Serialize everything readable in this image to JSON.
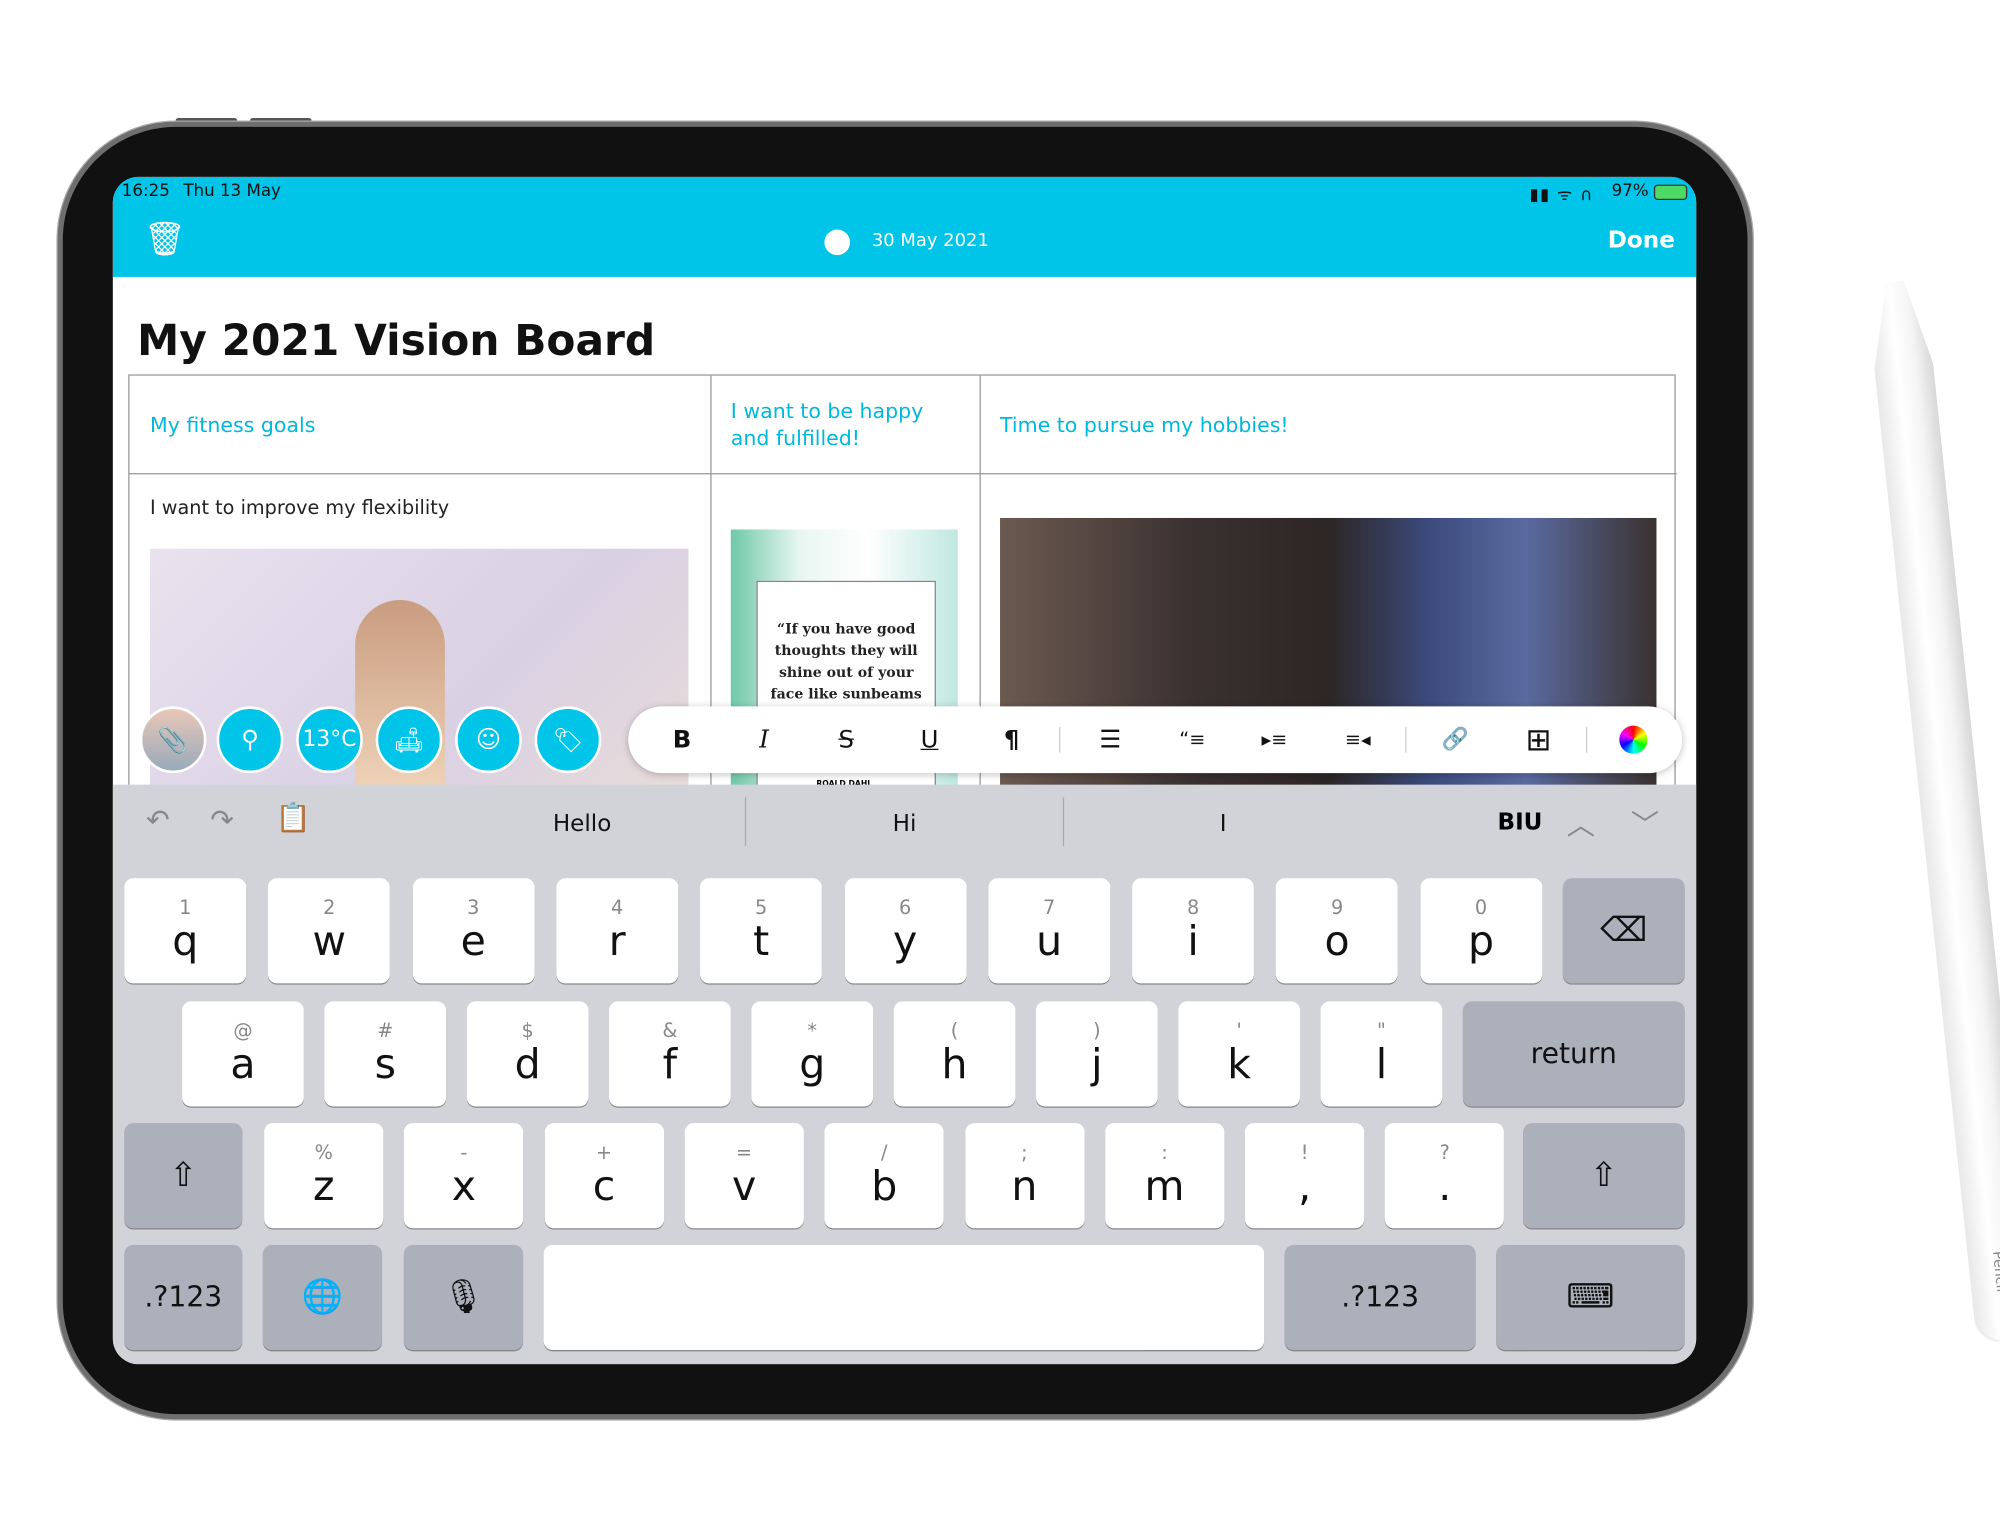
{
  "status_bar": {
    "time": "16:25",
    "date": "Thu 13 May",
    "battery": "97%"
  },
  "header": {
    "date": "30 May 2021",
    "done_label": "Done",
    "accent": "#00c4e8"
  },
  "document": {
    "title": "My 2021 Vision Board",
    "columns": [
      {
        "heading": "My fitness goals",
        "body": "I want to improve my flexibility"
      },
      {
        "heading": "I want to be happy and fulfilled!",
        "quote": "“If you have good thoughts they will shine out of your face like sunbeams",
        "author": "ROALD DAHL"
      },
      {
        "heading": "Time to pursue my hobbies!"
      }
    ]
  },
  "attachment_buttons": [
    {
      "icon": "paperclip-icon"
    },
    {
      "icon": "location-pin-icon"
    },
    {
      "icon": "weather",
      "label": "13°C"
    },
    {
      "icon": "sofa-icon"
    },
    {
      "icon": "smiley-icon"
    },
    {
      "icon": "tag-icon"
    }
  ],
  "format_toolbar": [
    {
      "icon": "bold-icon",
      "glyph": "B"
    },
    {
      "icon": "italic-icon",
      "glyph": "I"
    },
    {
      "icon": "strikethrough-icon",
      "glyph": "S"
    },
    {
      "icon": "underline-icon",
      "glyph": "U"
    },
    {
      "icon": "paragraph-icon",
      "glyph": "¶"
    },
    {
      "icon": "bullet-list-icon",
      "glyph": "☰"
    },
    {
      "icon": "quote-icon",
      "glyph": "“≡"
    },
    {
      "icon": "indent-icon",
      "glyph": "▸≡"
    },
    {
      "icon": "outdent-icon",
      "glyph": "≡◂"
    },
    {
      "icon": "link-icon",
      "glyph": "🔗"
    },
    {
      "icon": "table-icon",
      "glyph": "⊞"
    },
    {
      "icon": "color-wheel-icon",
      "glyph": ""
    }
  ],
  "keyboard": {
    "suggestions": [
      "Hello",
      "Hi",
      "I"
    ],
    "biu": "BIU",
    "row1": [
      [
        "1",
        "q"
      ],
      [
        "2",
        "w"
      ],
      [
        "3",
        "e"
      ],
      [
        "4",
        "r"
      ],
      [
        "5",
        "t"
      ],
      [
        "6",
        "y"
      ],
      [
        "7",
        "u"
      ],
      [
        "8",
        "i"
      ],
      [
        "9",
        "o"
      ],
      [
        "0",
        "p"
      ]
    ],
    "row2": [
      [
        "@",
        "a"
      ],
      [
        "#",
        "s"
      ],
      [
        "$",
        "d"
      ],
      [
        "&",
        "f"
      ],
      [
        "*",
        "g"
      ],
      [
        "(",
        "h"
      ],
      [
        ")",
        "j"
      ],
      [
        "'",
        "k"
      ],
      [
        "\"",
        "l"
      ]
    ],
    "row3": [
      [
        "%",
        "z"
      ],
      [
        "-",
        "x"
      ],
      [
        "+",
        "c"
      ],
      [
        "=",
        "v"
      ],
      [
        "/",
        "b"
      ],
      [
        ";",
        "n"
      ],
      [
        ":",
        "m"
      ],
      [
        "!",
        ","
      ],
      [
        "?",
        "."
      ]
    ],
    "return_label": "return",
    "numbers_label": ".?123"
  },
  "pencil_label": "Pencil"
}
